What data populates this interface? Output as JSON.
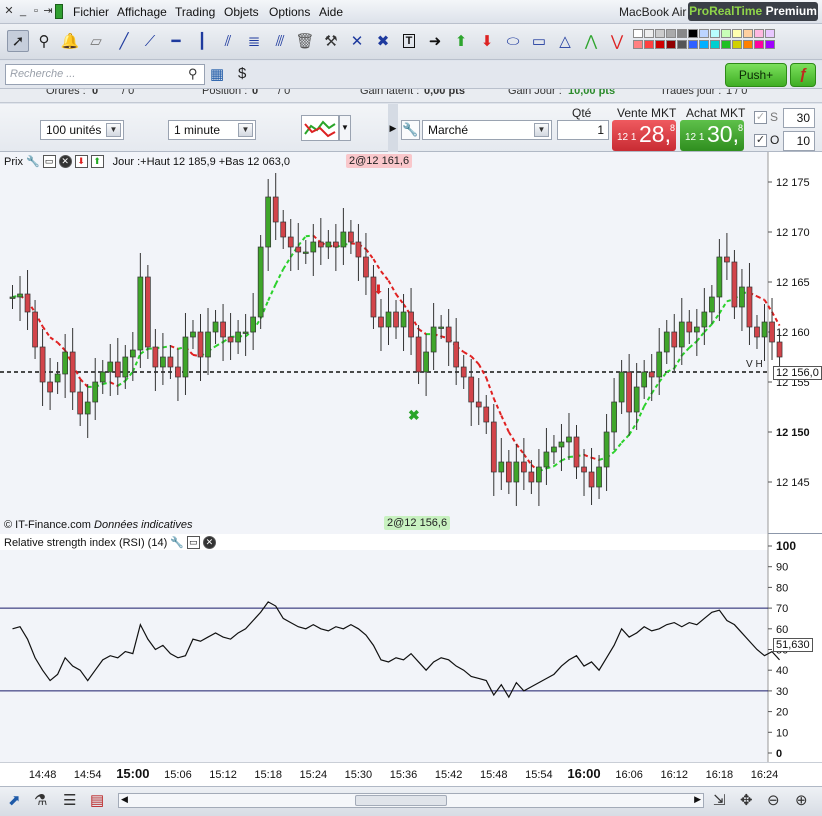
{
  "menubar": {
    "items": [
      "Fichier",
      "Affichage",
      "Trading",
      "Objets",
      "Options",
      "Aide"
    ],
    "device": "MacBook Air",
    "brand_main": "ProRealTime",
    "brand_suffix": "Premium"
  },
  "search": {
    "placeholder": "Recherche ..."
  },
  "push_button": "Push+",
  "status_row": {
    "orders_label": "Ordres :",
    "orders_value": "0",
    "orders_value2": "/ 0",
    "position_label": "Position :",
    "position_value": "0",
    "position_value2": "/ 0",
    "gain_latent_label": "Gain latent :",
    "gain_latent_value": "0,00 pts",
    "gain_jour_label": "Gain Jour :",
    "gain_jour_value": "10,00 pts",
    "trades_jour_label": "Trades jour :",
    "trades_jour_value": "1 / 0"
  },
  "controls": {
    "units": "100 unités",
    "timeframe": "1 minute",
    "order_type": "Marché",
    "qty_label": "Qté",
    "qty_value": "1",
    "sell_label": "Vente MKT",
    "buy_label": "Achat MKT",
    "sell_small": "12 1",
    "sell_big": "28,",
    "sell_sup": "8",
    "buy_small": "12 1",
    "buy_big": "30,",
    "buy_sup": "8",
    "s_label": "S",
    "s_value": "30",
    "o_label": "O",
    "o_value": "10",
    "s_checked": false,
    "o_checked": true
  },
  "price_pane": {
    "title": "Prix",
    "info": "Jour :+Haut 12 185,9 +Bas 12 063,0",
    "order_tag_top": "2@12 161,6",
    "order_tag_bottom": "2@12 156,6",
    "copyright": "© IT-Finance.com",
    "indicative": "Données indicatives",
    "last_price": "12 156,0",
    "last_price_note": "V H",
    "y_ticks": [
      "12 175",
      "12 170",
      "12 165",
      "12 160",
      "12 155",
      "12 150",
      "12 145"
    ]
  },
  "rsi_pane": {
    "title": "Relative strength index (RSI) (14)",
    "y_ticks": [
      "100",
      "90",
      "80",
      "70",
      "60",
      "50",
      "40",
      "30",
      "20",
      "10",
      "0"
    ],
    "current_value": "51,630"
  },
  "time_axis": {
    "labels": [
      "14:48",
      "14:54",
      "15:00",
      "15:06",
      "15:12",
      "15:18",
      "15:24",
      "15:30",
      "15:36",
      "15:42",
      "15:48",
      "15:54",
      "16:00",
      "16:06",
      "16:12",
      "16:18",
      "16:24"
    ],
    "bold_labels": [
      "15:00",
      "16:00"
    ]
  },
  "colors": {
    "up_candle": "#3fa52a",
    "down_candle": "#d2444a",
    "ma_up": "#2bd12b",
    "ma_down": "#e02020",
    "sell": "#d9363e",
    "buy": "#3a9a2a"
  },
  "chart_data": [
    {
      "type": "candlestick",
      "title": "Prix",
      "x": [
        "14:44",
        "14:45",
        "14:46",
        "14:47",
        "14:48",
        "14:49",
        "14:50",
        "14:51",
        "14:52",
        "14:53",
        "14:54",
        "14:55",
        "14:56",
        "14:57",
        "14:58",
        "14:59",
        "15:00",
        "15:01",
        "15:02",
        "15:03",
        "15:04",
        "15:05",
        "15:06",
        "15:07",
        "15:08",
        "15:09",
        "15:10",
        "15:11",
        "15:12",
        "15:13",
        "15:14",
        "15:15",
        "15:16",
        "15:17",
        "15:18",
        "15:19",
        "15:20",
        "15:21",
        "15:22",
        "15:23",
        "15:24",
        "15:25",
        "15:26",
        "15:27",
        "15:28",
        "15:29",
        "15:30",
        "15:31",
        "15:32",
        "15:33",
        "15:34",
        "15:35",
        "15:36",
        "15:37",
        "15:38",
        "15:39",
        "15:40",
        "15:41",
        "15:42",
        "15:43",
        "15:44",
        "15:45",
        "15:46",
        "15:47",
        "15:48",
        "15:49",
        "15:50",
        "15:51",
        "15:52",
        "15:53",
        "15:54",
        "15:55",
        "15:56",
        "15:57",
        "15:58",
        "15:59",
        "16:00",
        "16:01",
        "16:02",
        "16:03",
        "16:04",
        "16:05",
        "16:06",
        "16:07",
        "16:08",
        "16:09",
        "16:10",
        "16:11",
        "16:12",
        "16:13",
        "16:14",
        "16:15",
        "16:16",
        "16:17",
        "16:18",
        "16:19",
        "16:20",
        "16:21",
        "16:22",
        "16:23",
        "16:24",
        "16:25",
        "16:26"
      ],
      "open": [
        12163.5,
        12163.5,
        12163.8,
        12162.0,
        12158.5,
        12155.0,
        12155.0,
        12155.8,
        12158.0,
        12154.0,
        12151.8,
        12153.0,
        12155.0,
        12156.0,
        12157.0,
        12155.5,
        12157.5,
        12158.2,
        12165.5,
        12158.5,
        12156.5,
        12157.5,
        12156.5,
        12155.5,
        12159.5,
        12160.0,
        12157.5,
        12160.0,
        12161.0,
        12159.5,
        12159.0,
        12160.0,
        12160.0,
        12161.5,
        12168.5,
        12173.5,
        12171.0,
        12169.5,
        12168.5,
        12168.0,
        12168.0,
        12169.0,
        12168.5,
        12169.0,
        12168.5,
        12170.0,
        12169.0,
        12167.5,
        12165.5,
        12161.5,
        12160.5,
        12162.0,
        12160.5,
        12162.0,
        12159.5,
        12156.0,
        12158.0,
        12160.5,
        12160.5,
        12159.0,
        12156.5,
        12155.5,
        12153.0,
        12152.5,
        12151.0,
        12146.0,
        12147.0,
        12145.0,
        12147.0,
        12146.0,
        12145.0,
        12146.5,
        12148.0,
        12148.5,
        12149.0,
        12149.5,
        12146.5,
        12146.0,
        12144.5,
        12146.5,
        12150.0,
        12153.0,
        12156.0,
        12152.0,
        12154.5,
        12156.0,
        12155.5,
        12158.0,
        12160.0,
        12158.5,
        12161.0,
        12160.0,
        12160.5,
        12162.0,
        12163.5,
        12167.5,
        12167.0,
        12162.5,
        12164.5,
        12160.5,
        12159.5,
        12161.0,
        12159.0
      ],
      "close": [
        12163.5,
        12163.8,
        12162.0,
        12158.5,
        12155.0,
        12154.0,
        12155.8,
        12158.0,
        12154.0,
        12151.8,
        12153.0,
        12155.0,
        12156.0,
        12157.0,
        12155.5,
        12157.5,
        12158.2,
        12165.5,
        12158.5,
        12156.5,
        12157.5,
        12156.5,
        12155.5,
        12159.5,
        12160.0,
        12157.5,
        12160.0,
        12161.0,
        12159.5,
        12159.0,
        12160.0,
        12160.0,
        12161.5,
        12168.5,
        12173.5,
        12171.0,
        12169.5,
        12168.5,
        12168.0,
        12168.0,
        12169.0,
        12168.5,
        12169.0,
        12168.5,
        12170.0,
        12169.0,
        12167.5,
        12165.5,
        12161.5,
        12160.5,
        12162.0,
        12160.5,
        12162.0,
        12159.5,
        12156.0,
        12158.0,
        12160.5,
        12160.5,
        12159.0,
        12156.5,
        12155.5,
        12153.0,
        12152.5,
        12151.0,
        12146.0,
        12147.0,
        12145.0,
        12147.0,
        12146.0,
        12145.0,
        12146.5,
        12148.0,
        12148.5,
        12149.0,
        12149.5,
        12146.5,
        12146.0,
        12144.5,
        12146.5,
        12150.0,
        12153.0,
        12156.0,
        12152.0,
        12154.5,
        12156.0,
        12155.5,
        12158.0,
        12160.0,
        12158.5,
        12161.0,
        12160.0,
        12160.5,
        12162.0,
        12163.5,
        12167.5,
        12167.0,
        12162.5,
        12164.5,
        12160.5,
        12159.5,
        12161.0,
        12159.0,
        12157.5
      ],
      "ma_color_change": "green when rising, red when falling"
    },
    {
      "type": "line",
      "title": "Relative strength index (RSI) (14)",
      "ylim": [
        0,
        100
      ],
      "reference_lines": [
        70,
        30
      ],
      "x": [
        "14:44",
        "14:45",
        "14:46",
        "14:47",
        "14:48",
        "14:49",
        "14:50",
        "14:51",
        "14:52",
        "14:53",
        "14:54",
        "14:55",
        "14:56",
        "14:57",
        "14:58",
        "14:59",
        "15:00",
        "15:01",
        "15:02",
        "15:03",
        "15:04",
        "15:05",
        "15:06",
        "15:07",
        "15:08",
        "15:09",
        "15:10",
        "15:11",
        "15:12",
        "15:13",
        "15:14",
        "15:15",
        "15:16",
        "15:17",
        "15:18",
        "15:19",
        "15:20",
        "15:21",
        "15:22",
        "15:23",
        "15:24",
        "15:25",
        "15:26",
        "15:27",
        "15:28",
        "15:29",
        "15:30",
        "15:31",
        "15:32",
        "15:33",
        "15:34",
        "15:35",
        "15:36",
        "15:37",
        "15:38",
        "15:39",
        "15:40",
        "15:41",
        "15:42",
        "15:43",
        "15:44",
        "15:45",
        "15:46",
        "15:47",
        "15:48",
        "15:49",
        "15:50",
        "15:51",
        "15:52",
        "15:53",
        "15:54",
        "15:55",
        "15:56",
        "15:57",
        "15:58",
        "15:59",
        "16:00",
        "16:01",
        "16:02",
        "16:03",
        "16:04",
        "16:05",
        "16:06",
        "16:07",
        "16:08",
        "16:09",
        "16:10",
        "16:11",
        "16:12",
        "16:13",
        "16:14",
        "16:15",
        "16:16",
        "16:17",
        "16:18",
        "16:19",
        "16:20",
        "16:21",
        "16:22",
        "16:23",
        "16:24",
        "16:25",
        "16:26"
      ],
      "values": [
        60,
        61,
        55,
        46,
        40,
        35,
        38,
        46,
        42,
        40,
        35,
        40,
        45,
        47,
        46,
        49,
        48,
        62,
        55,
        50,
        52,
        48,
        46,
        47,
        55,
        54,
        56,
        58,
        56,
        55,
        58,
        60,
        64,
        68,
        73,
        71,
        65,
        63,
        61,
        60,
        62,
        60,
        59,
        61,
        60,
        62,
        60,
        57,
        52,
        45,
        44,
        46,
        45,
        48,
        44,
        40,
        44,
        46,
        45,
        42,
        40,
        37,
        36,
        35,
        28,
        33,
        27,
        34,
        30,
        32,
        34,
        36,
        38,
        42,
        45,
        47,
        42,
        44,
        40,
        46,
        52,
        60,
        56,
        58,
        61,
        59,
        60,
        62,
        63,
        61,
        63,
        62,
        65,
        68,
        69,
        64,
        62,
        58,
        54,
        50,
        47,
        49,
        45
      ]
    }
  ]
}
